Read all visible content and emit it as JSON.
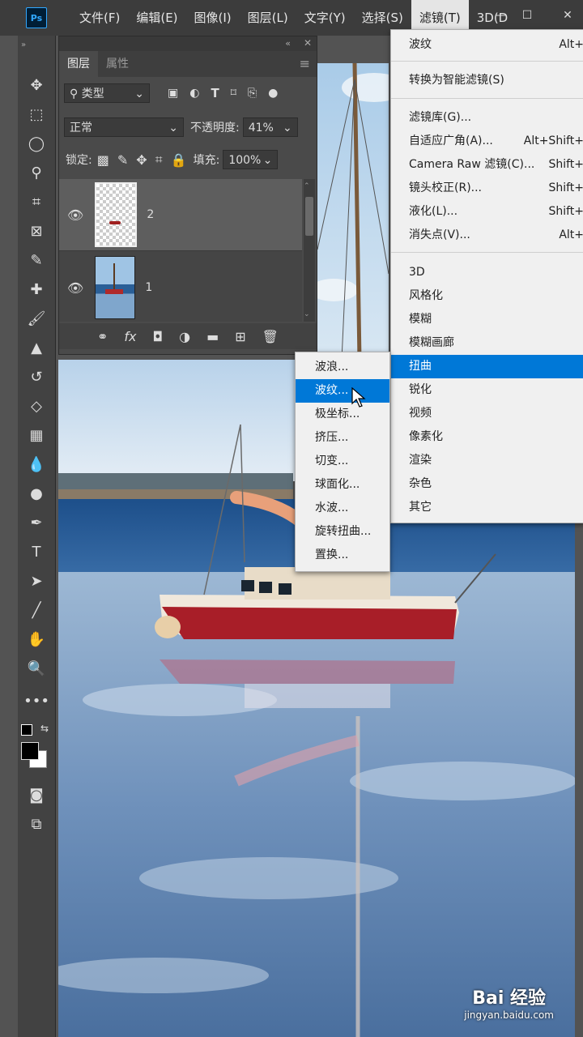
{
  "menubar": {
    "logo": "Ps",
    "items": [
      "文件(F)",
      "编辑(E)",
      "图像(I)",
      "图层(L)",
      "文字(Y)",
      "选择(S)",
      "滤镜(T)",
      "3D(D"
    ],
    "active_index": 6
  },
  "layers_panel": {
    "tabs": [
      "图层",
      "属性"
    ],
    "filter_label": "类型",
    "blend_mode": "正常",
    "opacity_label": "不透明度:",
    "opacity_value": "41%",
    "lock_label": "锁定:",
    "fill_label": "填充:",
    "fill_value": "100%",
    "layers": [
      {
        "name": "2",
        "selected": true
      },
      {
        "name": "1",
        "selected": false
      }
    ]
  },
  "filter_menu": {
    "items": [
      {
        "label": "波纹",
        "shortcut": "Alt+"
      },
      {
        "label": "转换为智能滤镜(S)",
        "shortcut": ""
      },
      {
        "label": "滤镜库(G)...",
        "shortcut": ""
      },
      {
        "label": "自适应广角(A)...",
        "shortcut": "Alt+Shift+"
      },
      {
        "label": "Camera Raw 滤镜(C)...",
        "shortcut": "Shift+"
      },
      {
        "label": "镜头校正(R)...",
        "shortcut": "Shift+"
      },
      {
        "label": "液化(L)...",
        "shortcut": "Shift+"
      },
      {
        "label": "消失点(V)...",
        "shortcut": "Alt+"
      },
      {
        "label": "3D",
        "shortcut": ""
      },
      {
        "label": "风格化",
        "shortcut": ""
      },
      {
        "label": "模糊",
        "shortcut": ""
      },
      {
        "label": "模糊画廊",
        "shortcut": ""
      },
      {
        "label": "扭曲",
        "shortcut": ""
      },
      {
        "label": "锐化",
        "shortcut": ""
      },
      {
        "label": "视频",
        "shortcut": ""
      },
      {
        "label": "像素化",
        "shortcut": ""
      },
      {
        "label": "渲染",
        "shortcut": ""
      },
      {
        "label": "杂色",
        "shortcut": ""
      },
      {
        "label": "其它",
        "shortcut": ""
      }
    ],
    "highlighted": "扭曲"
  },
  "distort_submenu": {
    "items": [
      "波浪...",
      "波纹...",
      "极坐标...",
      "挤压...",
      "切变...",
      "球面化...",
      "水波...",
      "旋转扭曲...",
      "置换..."
    ],
    "highlighted": "波纹..."
  },
  "watermark": {
    "brand": "Bai 经验",
    "url": "jingyan.baidu.com"
  },
  "colors": {
    "accent": "#0078d7",
    "ps_blue": "#31a8ff"
  }
}
